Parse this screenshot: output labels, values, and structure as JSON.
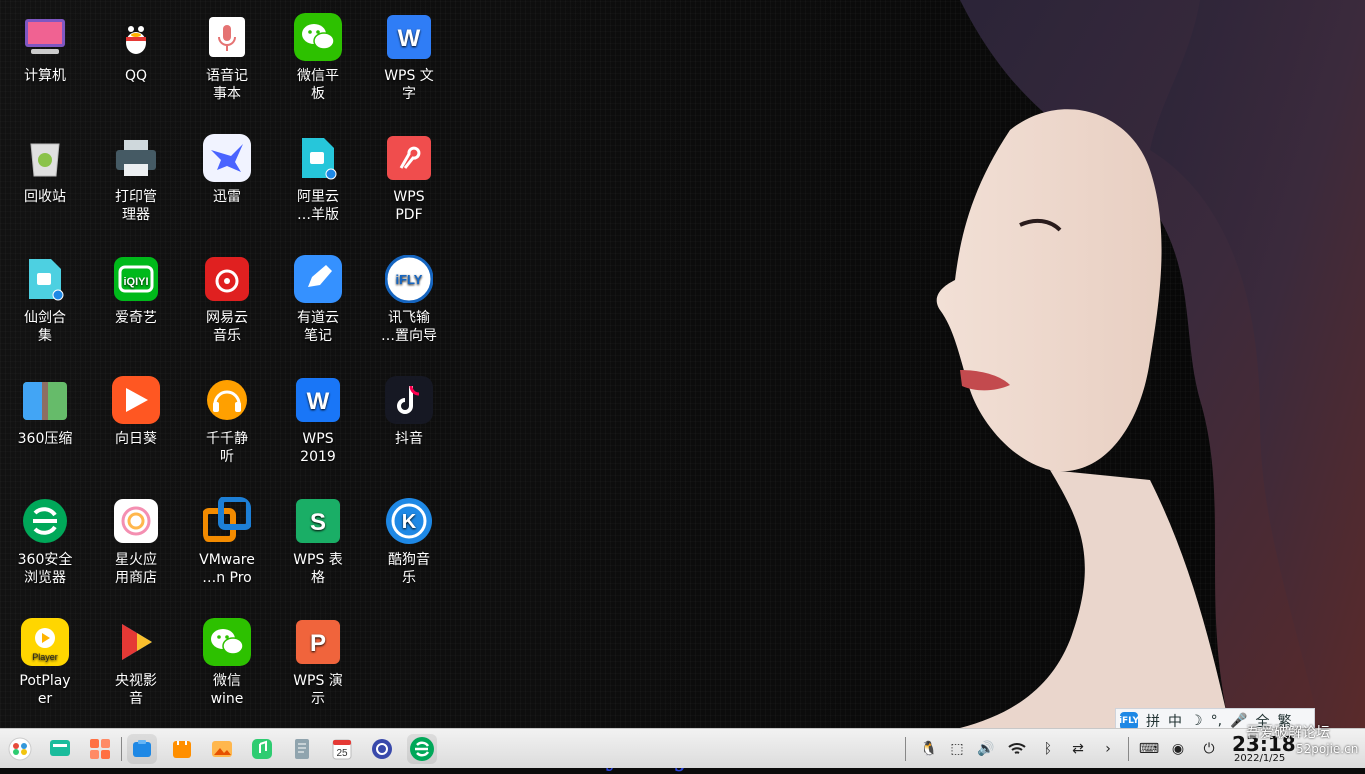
{
  "desktop_icons": [
    {
      "id": "computer",
      "label": "计算机",
      "icon": "computer-icon"
    },
    {
      "id": "qq",
      "label": "QQ",
      "icon": "qq-icon"
    },
    {
      "id": "voice",
      "label": "语音记\n事本",
      "icon": "voice-recorder-icon"
    },
    {
      "id": "wechat-pad",
      "label": "微信平\n板",
      "icon": "wechat-icon"
    },
    {
      "id": "wps-writer",
      "label": "WPS 文\n字",
      "icon": "wps-writer-icon"
    },
    {
      "id": "recycle",
      "label": "回收站",
      "icon": "trash-icon"
    },
    {
      "id": "print",
      "label": "打印管\n理器",
      "icon": "printer-icon"
    },
    {
      "id": "xunlei",
      "label": "迅雷",
      "icon": "xunlei-icon"
    },
    {
      "id": "aliyun",
      "label": "阿里云\n…羊版",
      "icon": "aliyun-icon"
    },
    {
      "id": "wps-pdf",
      "label": "WPS\nPDF",
      "icon": "wps-pdf-icon"
    },
    {
      "id": "xianjian",
      "label": "仙剑合\n集",
      "icon": "game-icon"
    },
    {
      "id": "iqiyi",
      "label": "爱奇艺",
      "icon": "iqiyi-icon"
    },
    {
      "id": "netease",
      "label": "网易云\n音乐",
      "icon": "netease-music-icon"
    },
    {
      "id": "youdao",
      "label": "有道云\n笔记",
      "icon": "youdao-note-icon"
    },
    {
      "id": "ifly",
      "label": "讯飞输\n…置向导",
      "icon": "ifly-icon"
    },
    {
      "id": "zip360",
      "label": "360压缩",
      "icon": "zip-icon"
    },
    {
      "id": "sunlogin",
      "label": "向日葵",
      "icon": "sunlogin-icon"
    },
    {
      "id": "ttplayer",
      "label": "千千静\n听",
      "icon": "headphones-icon"
    },
    {
      "id": "wps2019",
      "label": "WPS\n2019",
      "icon": "wps-icon"
    },
    {
      "id": "douyin",
      "label": "抖音",
      "icon": "douyin-icon"
    },
    {
      "id": "browser360",
      "label": "360安全\n浏览器",
      "icon": "browser-icon"
    },
    {
      "id": "spark",
      "label": "星火应\n用商店",
      "icon": "store-icon"
    },
    {
      "id": "vmware",
      "label": "VMware\n…n Pro",
      "icon": "vmware-icon"
    },
    {
      "id": "wps-sheet",
      "label": "WPS 表\n格",
      "icon": "wps-sheet-icon"
    },
    {
      "id": "kugou",
      "label": "酷狗音\n乐",
      "icon": "kugou-icon"
    },
    {
      "id": "potplayer",
      "label": "PotPlay\ner",
      "icon": "potplayer-icon"
    },
    {
      "id": "cctv",
      "label": "央视影\n音",
      "icon": "cctv-icon"
    },
    {
      "id": "wechat-wine",
      "label": "微信\nwine",
      "icon": "wechat-icon"
    },
    {
      "id": "wps-ppt",
      "label": "WPS 演\n示",
      "icon": "wps-ppt-icon"
    }
  ],
  "watermark": "缘聚岛-yuanjudao.com",
  "ime": {
    "mode": "拼",
    "lang": "中",
    "moon": "☽",
    "punct": "°,",
    "mic": "🎤",
    "width": "全",
    "trad": "繁"
  },
  "clock": {
    "time": "23:18",
    "date": "2022/1/25"
  },
  "forum": {
    "line1": "吾爱破解论坛",
    "line2": "52pojie.cn"
  },
  "colors": {
    "taskbar": "#e6e6e6",
    "accent": "#2a44d8"
  }
}
